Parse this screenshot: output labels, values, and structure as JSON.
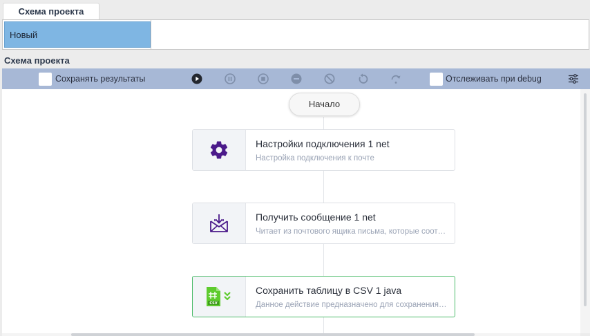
{
  "tab": {
    "label": "Схема проекта"
  },
  "top_panel": {
    "selected_item": "Новый"
  },
  "section": {
    "title": "Схема проекта"
  },
  "toolbar": {
    "save_results_label": "Сохранять результаты",
    "track_debug_label": "Отслеживать при debug",
    "buttons": [
      "play-icon",
      "pause-icon",
      "stop-icon",
      "stop-all-icon",
      "cancel-icon",
      "restart-icon",
      "redo-icon",
      "settings-sliders-icon"
    ]
  },
  "flow": {
    "start_label": "Начало",
    "nodes": [
      {
        "title": "Настройки подключения  1  net",
        "desc": "Настройка подключения к почте",
        "icon": "gear-icon"
      },
      {
        "title": "Получить сообщение  1  net",
        "desc": "Читает из почтового ящика письма, которые соответствуют условиям",
        "icon": "mail-download-icon"
      },
      {
        "title": "Сохранить таблицу в CSV  1  java",
        "desc": "Данное действие предназначено для сохранения таблицы в CSV",
        "icon": "csv-file-icon"
      }
    ]
  },
  "colors": {
    "toolbar_bg": "#a7b8d6",
    "selected_item": "#7fb6e3",
    "node_selected_border": "#4cbb6a",
    "icon_purple": "#4b1a8a",
    "csv_green": "#5ecb2e"
  }
}
